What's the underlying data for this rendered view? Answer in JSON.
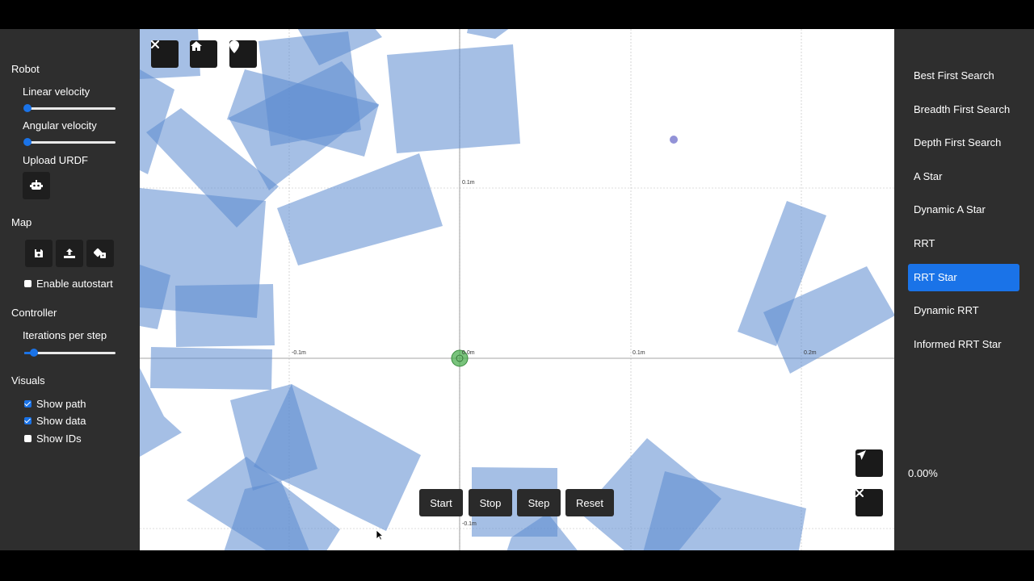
{
  "left": {
    "robot": {
      "title": "Robot",
      "linear_velocity_label": "Linear velocity",
      "linear_velocity_value": 0.02,
      "angular_velocity_label": "Angular velocity",
      "angular_velocity_value": 0.02,
      "upload_urdf_label": "Upload URDF",
      "urdf_icon": "robot-icon"
    },
    "map": {
      "title": "Map",
      "icons": [
        "save-icon",
        "upload-icon",
        "dice-icon"
      ],
      "autostart_label": "Enable autostart",
      "autostart_checked": false
    },
    "controller": {
      "title": "Controller",
      "iterations_label": "Iterations per step",
      "iterations_value": 0.1
    },
    "visuals": {
      "title": "Visuals",
      "show_path_label": "Show path",
      "show_path": true,
      "show_data_label": "Show data",
      "show_data": true,
      "show_ids_label": "Show IDs",
      "show_ids": false
    }
  },
  "canvas": {
    "top_icons": [
      "close-icon",
      "home-icon",
      "map-pin-icon"
    ],
    "axis_labels": {
      "x_neg": "-0.1m",
      "x_origin": "0.0m",
      "x_pos1": "0.1m",
      "x_pos2": "0.2m",
      "y_pos": "0.1m",
      "y_neg": "-0.1m"
    },
    "controls": {
      "start": "Start",
      "stop": "Stop",
      "step": "Step",
      "reset": "Reset"
    },
    "corner_icons": [
      "navigation-icon",
      "close-icon"
    ],
    "colors": {
      "obstacle": "#5b8bd0",
      "robot": "#4caf50",
      "goal": "#7f7fd0"
    }
  },
  "right": {
    "algorithms": [
      "Best First Search",
      "Breadth First Search",
      "Depth First Search",
      "A Star",
      "Dynamic A Star",
      "RRT",
      "RRT Star",
      "Dynamic RRT",
      "Informed RRT Star"
    ],
    "selected": "RRT Star",
    "progress": "0.00%"
  }
}
